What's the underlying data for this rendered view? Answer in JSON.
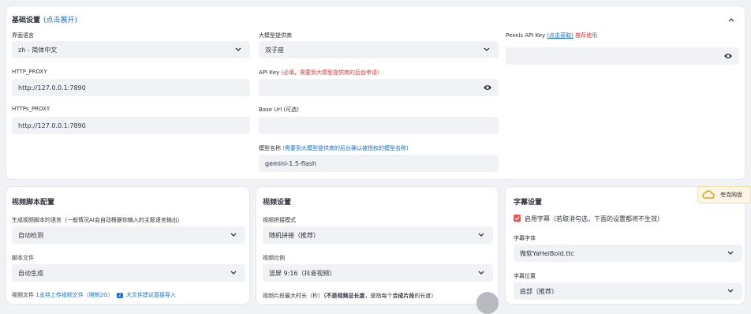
{
  "basic": {
    "title": "基础设置",
    "expand_hint": "(点击展开)",
    "language": {
      "label": "界面语言",
      "value": "zh - 简体中文"
    },
    "provider": {
      "label": "大模型提供商",
      "value": "双子座"
    },
    "pexels": {
      "label": "Pexels API Key",
      "link": "(点击获取)",
      "recommend": "推荐使用",
      "value": ""
    },
    "http_proxy": {
      "label": "HTTP_PROXY",
      "value": "http://127.0.0.1:7890"
    },
    "https_proxy": {
      "label": "HTTPs_PROXY",
      "value": "http://127.0.0.1:7890"
    },
    "api_key": {
      "label": "API Key",
      "note": "(必填，需要到大模型提供商的后台申请)",
      "value": ""
    },
    "base_url": {
      "label": "Base Url",
      "note": "(可选)",
      "value": ""
    },
    "model": {
      "label": "模型名称",
      "note": "(需要到大模型提供商的后台确认被授权的模型名称)",
      "value": "gemini-1.5-flash"
    }
  },
  "script": {
    "title": "视频脚本配置",
    "script_lang": {
      "label": "生成视频脚本的语言（一般情况AI会自动根据你输入的主题语言输出）",
      "value": "自动检测"
    },
    "script_file": {
      "label": "脚本文件",
      "value": "自动生成"
    },
    "video_file": {
      "label": "视频文件",
      "part1": "1支持上传视频文件（限制2G）",
      "badge": "2",
      "part2": "大文件建议直接导入"
    }
  },
  "video": {
    "title": "视频设置",
    "concat_mode": {
      "label": "视频拼接模式",
      "value": "随机拼接（推荐）"
    },
    "aspect": {
      "label": "视频比例",
      "value": "竖屏 9:16（抖音视频）"
    },
    "clip_duration": {
      "label_prefix": "视频片段最大时长（秒）",
      "bold1": "（不是视频总长度",
      "mid": "，是指每个",
      "bold2": "合成片段",
      "suffix": "的长度）"
    }
  },
  "subtitle": {
    "title": "字幕设置",
    "enable": {
      "label": "启用字幕（若取消勾选，下面的设置都将不生效）",
      "checked": true
    },
    "font": {
      "label": "字幕字体",
      "value": "微软YaHeiBold.ttc"
    },
    "position": {
      "label": "字幕位置",
      "value": "底部（推荐）"
    }
  },
  "cloud_widget": {
    "label": "夸克网盘"
  },
  "colors": {
    "accent": "#ff4b4b",
    "link": "#1c6ed1",
    "field_bg": "#f0f2f6"
  }
}
